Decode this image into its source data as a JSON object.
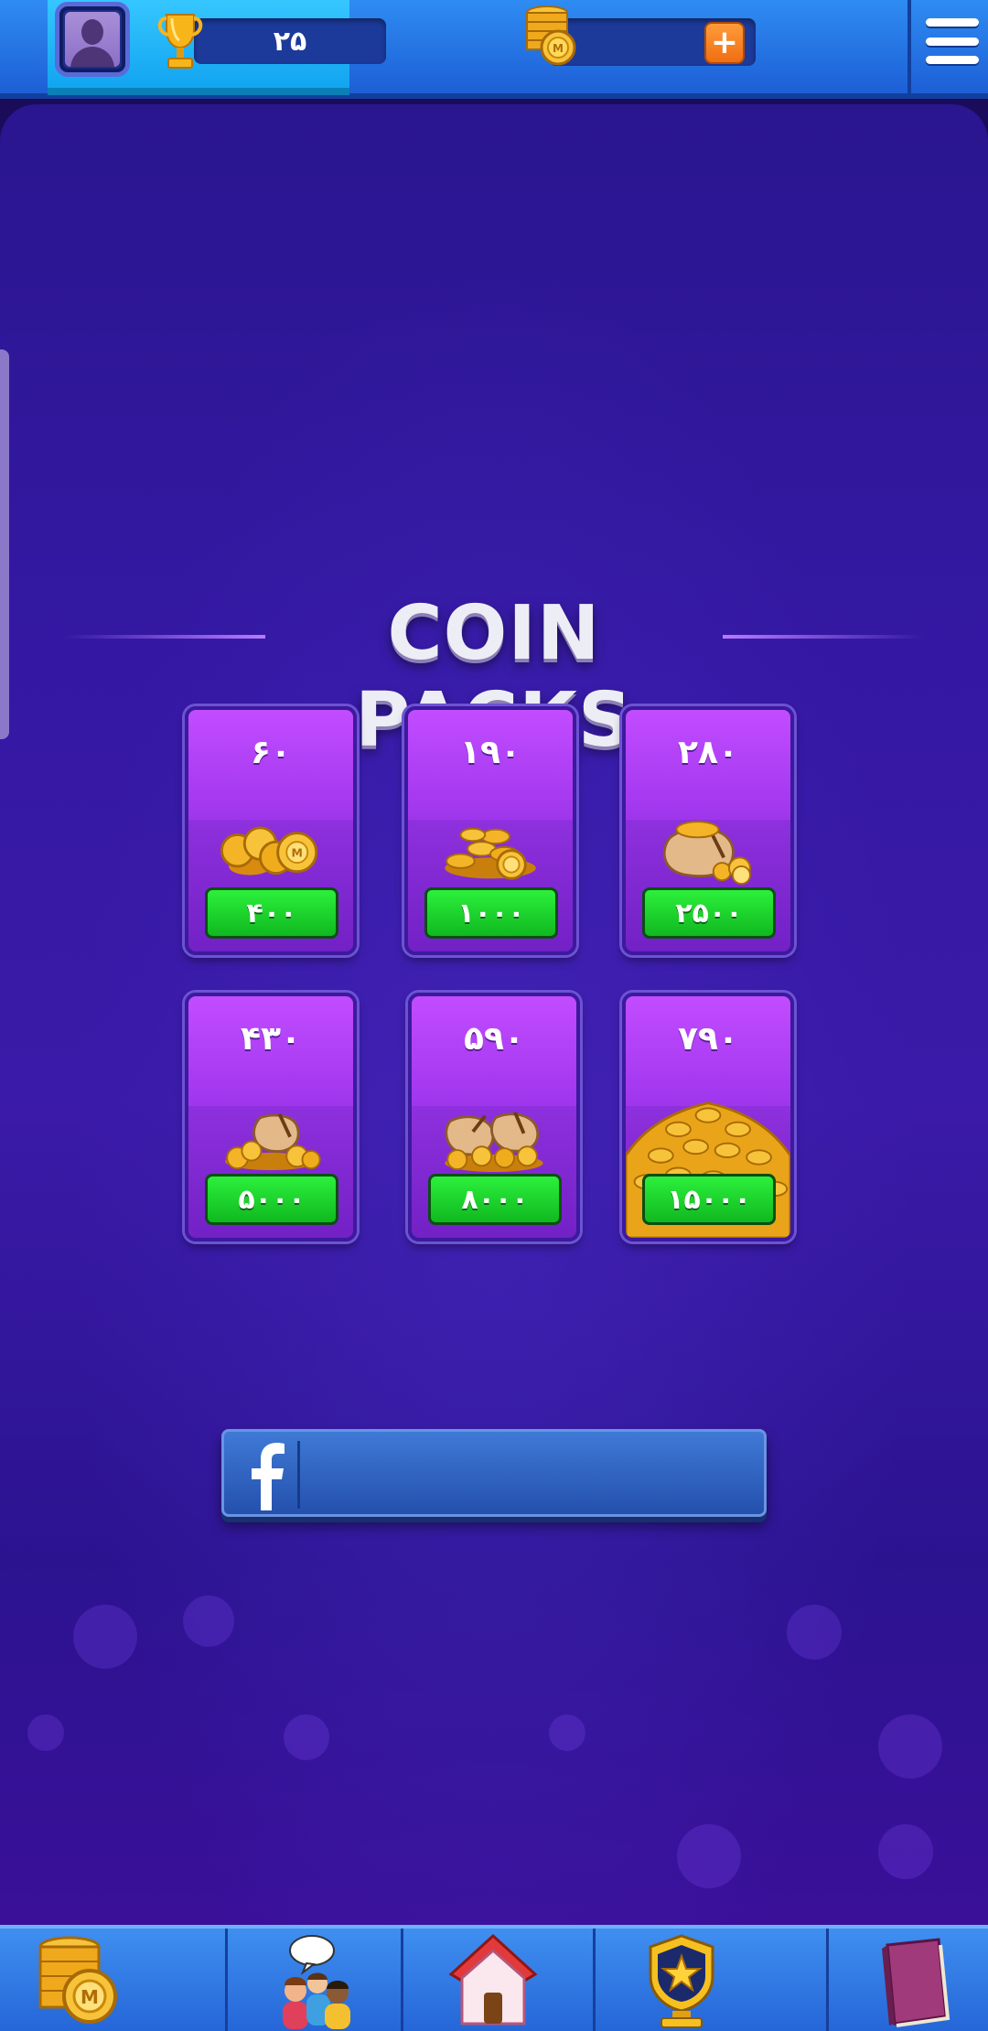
{
  "header": {
    "trophy_count": "۲۵",
    "add_coins_label": "+"
  },
  "main": {
    "title": "COIN PACKS",
    "packs": [
      {
        "amount": "۶۰",
        "price": "۴۰۰"
      },
      {
        "amount": "۱۹۰",
        "price": "۱۰۰۰"
      },
      {
        "amount": "۲۸۰",
        "price": "۲۵۰۰"
      },
      {
        "amount": "۴۳۰",
        "price": "۵۰۰۰"
      },
      {
        "amount": "۵۹۰",
        "price": "۸۰۰۰"
      },
      {
        "amount": "۷۹۰",
        "price": "۱۵۰۰۰"
      }
    ],
    "facebook_button": {
      "icon": "facebook-icon",
      "label": ""
    }
  },
  "bottom_nav": {
    "items": [
      {
        "icon": "coin-stack-icon"
      },
      {
        "icon": "friends-chat-icon"
      },
      {
        "icon": "home-icon"
      },
      {
        "icon": "trophy-star-icon"
      },
      {
        "icon": "book-icon"
      }
    ]
  },
  "colors": {
    "buy_button": "#15c425",
    "card_top": "#c24cff",
    "background": "#3418a3",
    "nav_bar": "#2f7ae8"
  }
}
